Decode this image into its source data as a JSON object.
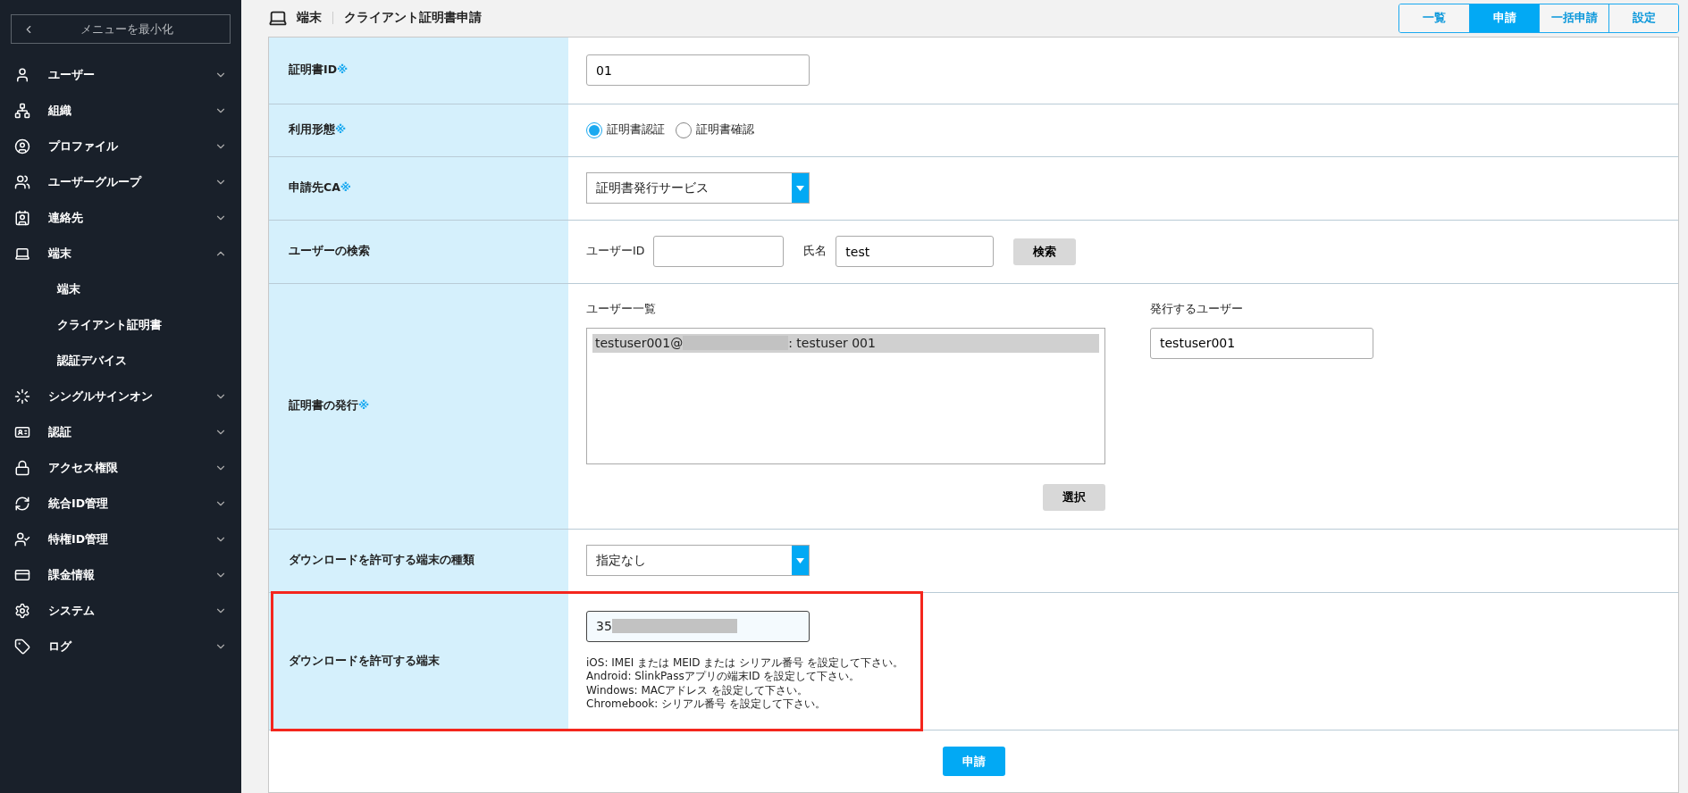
{
  "sidebar": {
    "collapse_button": "メニューを最小化",
    "items": [
      {
        "label": "ユーザー",
        "expanded": false
      },
      {
        "label": "組織",
        "expanded": false
      },
      {
        "label": "プロファイル",
        "expanded": false
      },
      {
        "label": "ユーザーグループ",
        "expanded": false
      },
      {
        "label": "連絡先",
        "expanded": false
      },
      {
        "label": "端末",
        "expanded": true,
        "children": [
          {
            "label": "端末"
          },
          {
            "label": "クライアント証明書"
          },
          {
            "label": "認証デバイス"
          }
        ]
      },
      {
        "label": "シングルサインオン",
        "expanded": false
      },
      {
        "label": "認証",
        "expanded": false
      },
      {
        "label": "アクセス権限",
        "expanded": false
      },
      {
        "label": "統合ID管理",
        "expanded": false
      },
      {
        "label": "特権ID管理",
        "expanded": false
      },
      {
        "label": "課金情報",
        "expanded": false
      },
      {
        "label": "システム",
        "expanded": false
      },
      {
        "label": "ログ",
        "expanded": false
      }
    ]
  },
  "header": {
    "section": "端末",
    "title": "クライアント証明書申請"
  },
  "tabs": [
    {
      "label": "一覧",
      "selected": false
    },
    {
      "label": "申請",
      "selected": true
    },
    {
      "label": "一括申請",
      "selected": false
    },
    {
      "label": "設定",
      "selected": false
    }
  ],
  "form": {
    "rows": [
      {
        "kind": "text",
        "label": "証明書ID",
        "required_mark": "※",
        "value": "01"
      },
      {
        "kind": "radio",
        "label": "利用形態",
        "required_mark": "※",
        "options": [
          {
            "label": "証明書認証",
            "selected": true
          },
          {
            "label": "証明書確認",
            "selected": false
          }
        ]
      },
      {
        "kind": "select",
        "label": "申請先CA",
        "required_mark": "※",
        "value": "証明書発行サービス"
      },
      {
        "kind": "search",
        "label": "ユーザーの検索",
        "fields": [
          {
            "label": "ユーザーID"
          },
          {
            "label": "氏名",
            "value": "test"
          }
        ],
        "button": "検索"
      },
      {
        "kind": "issue",
        "label": "証明書の発行",
        "required_mark": "※",
        "list_label": "ユーザー一覧",
        "list_items": [
          {
            "prefix": "testuser001@",
            "suffix": ": testuser 001",
            "selected": true
          }
        ],
        "button": "選択",
        "issued_label": "発行するユーザー",
        "issued_value": "testuser001"
      },
      {
        "kind": "select",
        "label": "ダウンロードを許可する端末の種類",
        "value": "指定なし"
      },
      {
        "kind": "device",
        "label": "ダウンロードを許可する端末",
        "value": "35",
        "highlighted": true,
        "notes": [
          "iOS: IMEI または MEID または シリアル番号 を設定して下さい。",
          "Android: SlinkPassアプリの端末ID を設定して下さい。",
          "Windows: MACアドレス を設定して下さい。",
          "Chromebook: シリアル番号 を設定して下さい。"
        ]
      }
    ],
    "submit": "申請"
  }
}
